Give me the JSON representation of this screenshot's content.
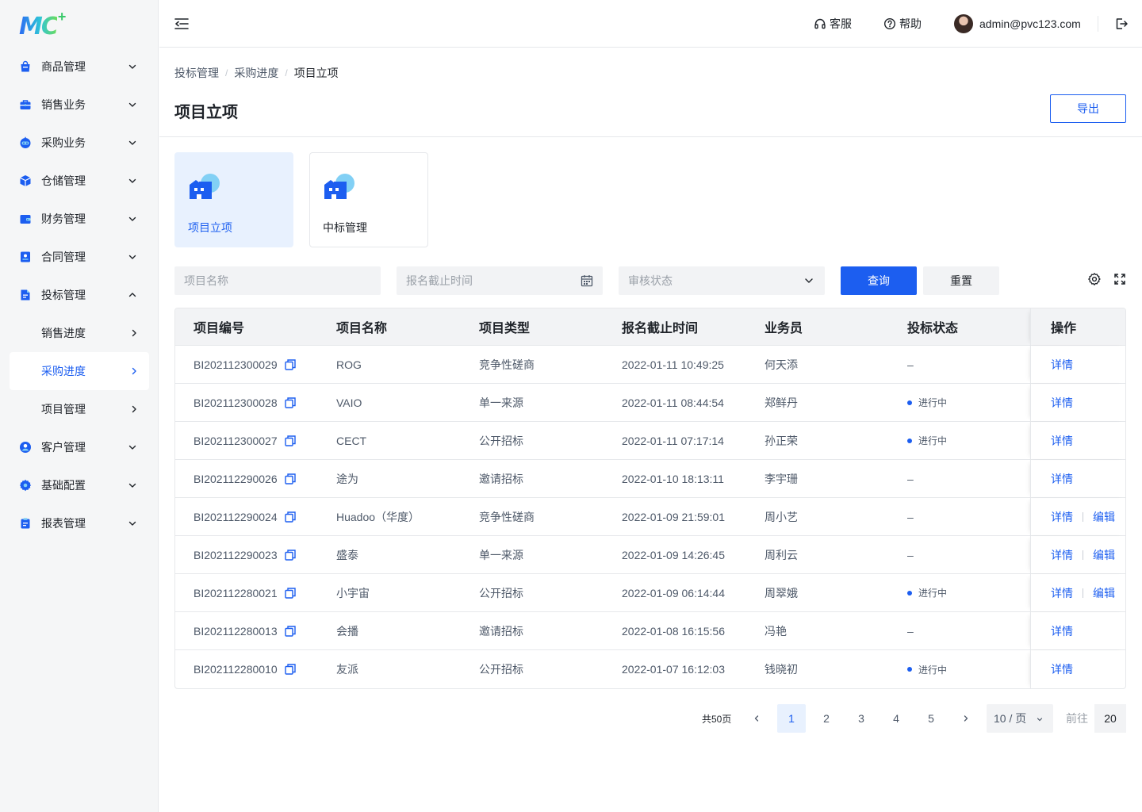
{
  "brand": {
    "logo_text": "MC",
    "logo_plus": "+"
  },
  "sidebar": {
    "items": [
      {
        "label": "商品管理",
        "icon": "bag-icon"
      },
      {
        "label": "销售业务",
        "icon": "briefcase-icon"
      },
      {
        "label": "采购业务",
        "icon": "robot-icon"
      },
      {
        "label": "仓储管理",
        "icon": "cube-icon"
      },
      {
        "label": "财务管理",
        "icon": "wallet-icon"
      },
      {
        "label": "合同管理",
        "icon": "contract-icon"
      },
      {
        "label": "投标管理",
        "icon": "bid-document-icon",
        "expanded": true
      },
      {
        "label": "客户管理",
        "icon": "user-circle-icon"
      },
      {
        "label": "基础配置",
        "icon": "settings-icon"
      },
      {
        "label": "报表管理",
        "icon": "clipboard-icon"
      }
    ],
    "bid_sub_items": [
      {
        "label": "销售进度",
        "active": false
      },
      {
        "label": "采购进度",
        "active": true
      },
      {
        "label": "项目管理",
        "active": false
      }
    ]
  },
  "header": {
    "service_label": "客服",
    "help_label": "帮助",
    "user_email": "admin@pvc123.com"
  },
  "breadcrumb": [
    "投标管理",
    "采购进度",
    "项目立项"
  ],
  "page": {
    "title": "项目立项",
    "export_label": "导出"
  },
  "cards": [
    {
      "label": "项目立项",
      "active": true
    },
    {
      "label": "中标管理",
      "active": false
    }
  ],
  "filters": {
    "name_placeholder": "项目名称",
    "deadline_placeholder": "报名截止时间",
    "status_placeholder": "审核状态",
    "query_label": "查询",
    "reset_label": "重置"
  },
  "table": {
    "columns": [
      "项目编号",
      "项目名称",
      "项目类型",
      "报名截止时间",
      "业务员",
      "投标状态",
      "操作"
    ],
    "rows": [
      {
        "id": "BI202112300029",
        "name": "ROG",
        "type": "竞争性磋商",
        "deadline": "2022-01-11 10:49:25",
        "staff": "何天添",
        "status": "–",
        "in_progress": false,
        "detail": "详情",
        "edit": ""
      },
      {
        "id": "BI202112300028",
        "name": "VAIO",
        "type": "单一来源",
        "deadline": "2022-01-11 08:44:54",
        "staff": "郑鲜丹",
        "status": "进行中",
        "in_progress": true,
        "detail": "详情",
        "edit": ""
      },
      {
        "id": "BI202112300027",
        "name": "CECT",
        "type": "公开招标",
        "deadline": "2022-01-11 07:17:14",
        "staff": "孙正荣",
        "status": "进行中",
        "in_progress": true,
        "detail": "详情",
        "edit": ""
      },
      {
        "id": "BI202112290026",
        "name": "途为",
        "type": "邀请招标",
        "deadline": "2022-01-10 18:13:11",
        "staff": "李宇珊",
        "status": "–",
        "in_progress": false,
        "detail": "详情",
        "edit": ""
      },
      {
        "id": "BI202112290024",
        "name": "Huadoo（华度）",
        "type": "竞争性磋商",
        "deadline": "2022-01-09 21:59:01",
        "staff": "周小艺",
        "status": "–",
        "in_progress": false,
        "detail": "详情",
        "edit": "编辑"
      },
      {
        "id": "BI202112290023",
        "name": "盛泰",
        "type": "单一来源",
        "deadline": "2022-01-09 14:26:45",
        "staff": "周利云",
        "status": "–",
        "in_progress": false,
        "detail": "详情",
        "edit": "编辑"
      },
      {
        "id": "BI202112280021",
        "name": "小宇宙",
        "type": "公开招标",
        "deadline": "2022-01-09 06:14:44",
        "staff": "周翠娥",
        "status": "进行中",
        "in_progress": true,
        "detail": "详情",
        "edit": "编辑"
      },
      {
        "id": "BI202112280013",
        "name": "会播",
        "type": "邀请招标",
        "deadline": "2022-01-08 16:15:56",
        "staff": "冯艳",
        "status": "–",
        "in_progress": false,
        "detail": "详情",
        "edit": ""
      },
      {
        "id": "BI202112280010",
        "name": "友派",
        "type": "公开招标",
        "deadline": "2022-01-07 16:12:03",
        "staff": "钱晓初",
        "status": "进行中",
        "in_progress": true,
        "detail": "详情",
        "edit": ""
      }
    ]
  },
  "pagination": {
    "total_label": "共50页",
    "pages": [
      "1",
      "2",
      "3",
      "4",
      "5"
    ],
    "current": "1",
    "page_size_label": "10 / 页",
    "goto_label": "前往",
    "goto_value": "20"
  },
  "colors": {
    "primary": "#1c5ef0",
    "sidebar_bg": "#f5f6f7",
    "card_active_bg": "#e8f1fe"
  }
}
